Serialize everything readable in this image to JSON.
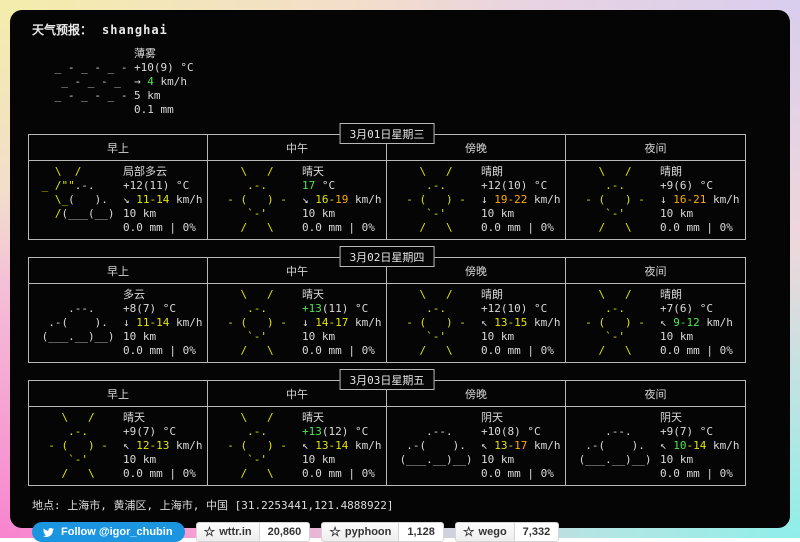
{
  "header": {
    "label": "天气预报：",
    "location": "shanghai"
  },
  "colors": {
    "green": "#4fe44f",
    "yellow": "#e3e300",
    "orange": "#ffaa00",
    "text": "#d9d9d9",
    "panel_bg": "#050505",
    "twitter_blue": "#1b95e0"
  },
  "arts": {
    "mist": [
      [],
      [
        {
          "t": " _ - _ - _ -",
          "c": "w"
        }
      ],
      [
        {
          "t": "  _ - _ - _",
          "c": "w"
        }
      ],
      [
        {
          "t": " _ - _ - _ -",
          "c": "w"
        }
      ],
      []
    ],
    "sunny": [
      [
        {
          "t": "    \\   /",
          "c": "y"
        }
      ],
      [
        {
          "t": "     .-.",
          "c": "y"
        }
      ],
      [
        {
          "t": "  - (   ) -",
          "c": "y"
        }
      ],
      [
        {
          "t": "     `-'",
          "c": "y"
        }
      ],
      [
        {
          "t": "    /   \\",
          "c": "y"
        }
      ]
    ],
    "partly_cloudy": [
      [
        {
          "t": "   \\  /",
          "c": "y"
        }
      ],
      [
        {
          "t": " _ /\"\"",
          "c": "y"
        },
        {
          "t": ".-.",
          "c": "w"
        }
      ],
      [
        {
          "t": "   \\_",
          "c": "y"
        },
        {
          "t": "(   ).",
          "c": "w"
        }
      ],
      [
        {
          "t": "   /",
          "c": "y"
        },
        {
          "t": "(___(__)",
          "c": "w"
        }
      ],
      []
    ],
    "cloudy": [
      [],
      [
        {
          "t": "     .--.",
          "c": "w"
        }
      ],
      [
        {
          "t": "  .-(    ).",
          "c": "w"
        }
      ],
      [
        {
          "t": " (___.__)__)",
          "c": "w"
        }
      ],
      []
    ]
  },
  "current": {
    "art": "mist",
    "condition": "薄雾",
    "temp": [
      {
        "t": "+10(9) °C",
        "c": "w"
      }
    ],
    "wind": [
      {
        "t": "→ ",
        "c": "w"
      },
      {
        "t": "4",
        "c": "g"
      },
      {
        "t": " km/h",
        "c": "w"
      }
    ],
    "visibility": "5 km",
    "precip": "0.1 mm"
  },
  "days": [
    {
      "title": "3月01日星期三",
      "periods": [
        "早上",
        "中午",
        "傍晚",
        "夜间"
      ],
      "cells": [
        {
          "art": "partly_cloudy",
          "condition": "局部多云",
          "temp": [
            {
              "t": "+12(11) °C",
              "c": "w"
            }
          ],
          "wind": [
            {
              "t": "↘ ",
              "c": "w"
            },
            {
              "t": "11-14",
              "c": "y"
            },
            {
              "t": " km/h",
              "c": "w"
            }
          ],
          "visibility": "10 km",
          "precip": "0.0 mm | 0%"
        },
        {
          "art": "sunny",
          "condition": "晴天",
          "temp": [
            {
              "t": "17",
              "c": "g"
            },
            {
              "t": " °C",
              "c": "w"
            }
          ],
          "wind": [
            {
              "t": "↘ ",
              "c": "w"
            },
            {
              "t": "16-",
              "c": "y"
            },
            {
              "t": "19",
              "c": "o"
            },
            {
              "t": " km/h",
              "c": "w"
            }
          ],
          "visibility": "10 km",
          "precip": "0.0 mm | 0%"
        },
        {
          "art": "sunny",
          "condition": "晴朗",
          "temp": [
            {
              "t": "+12(10) °C",
              "c": "w"
            }
          ],
          "wind": [
            {
              "t": "↓ ",
              "c": "w"
            },
            {
              "t": "19-22",
              "c": "o"
            },
            {
              "t": " km/h",
              "c": "w"
            }
          ],
          "visibility": "10 km",
          "precip": "0.0 mm | 0%"
        },
        {
          "art": "sunny",
          "condition": "晴朗",
          "temp": [
            {
              "t": "+9(6) °C",
              "c": "w"
            }
          ],
          "wind": [
            {
              "t": "↓ ",
              "c": "w"
            },
            {
              "t": "16-21",
              "c": "o"
            },
            {
              "t": " km/h",
              "c": "w"
            }
          ],
          "visibility": "10 km",
          "precip": "0.0 mm | 0%"
        }
      ]
    },
    {
      "title": "3月02日星期四",
      "periods": [
        "早上",
        "中午",
        "傍晚",
        "夜间"
      ],
      "cells": [
        {
          "art": "cloudy",
          "condition": "多云",
          "temp": [
            {
              "t": "+8(7) °C",
              "c": "w"
            }
          ],
          "wind": [
            {
              "t": "↓ ",
              "c": "w"
            },
            {
              "t": "11-14",
              "c": "y"
            },
            {
              "t": " km/h",
              "c": "w"
            }
          ],
          "visibility": "10 km",
          "precip": "0.0 mm | 0%"
        },
        {
          "art": "sunny",
          "condition": "晴天",
          "temp": [
            {
              "t": "+13",
              "c": "g"
            },
            {
              "t": "(11) °C",
              "c": "w"
            }
          ],
          "wind": [
            {
              "t": "↓ ",
              "c": "w"
            },
            {
              "t": "14-17",
              "c": "y"
            },
            {
              "t": " km/h",
              "c": "w"
            }
          ],
          "visibility": "10 km",
          "precip": "0.0 mm | 0%"
        },
        {
          "art": "sunny",
          "condition": "晴朗",
          "temp": [
            {
              "t": "+12(10) °C",
              "c": "w"
            }
          ],
          "wind": [
            {
              "t": "↖ ",
              "c": "w"
            },
            {
              "t": "13-15",
              "c": "y"
            },
            {
              "t": " km/h",
              "c": "w"
            }
          ],
          "visibility": "10 km",
          "precip": "0.0 mm | 0%"
        },
        {
          "art": "sunny",
          "condition": "晴朗",
          "temp": [
            {
              "t": "+7(6) °C",
              "c": "w"
            }
          ],
          "wind": [
            {
              "t": "↖ ",
              "c": "w"
            },
            {
              "t": "9-12",
              "c": "g"
            },
            {
              "t": " km/h",
              "c": "w"
            }
          ],
          "visibility": "10 km",
          "precip": "0.0 mm | 0%"
        }
      ]
    },
    {
      "title": "3月03日星期五",
      "periods": [
        "早上",
        "中午",
        "傍晚",
        "夜间"
      ],
      "cells": [
        {
          "art": "sunny",
          "condition": "晴天",
          "temp": [
            {
              "t": "+9(7) °C",
              "c": "w"
            }
          ],
          "wind": [
            {
              "t": "↖ ",
              "c": "w"
            },
            {
              "t": "12-13",
              "c": "y"
            },
            {
              "t": " km/h",
              "c": "w"
            }
          ],
          "visibility": "10 km",
          "precip": "0.0 mm | 0%"
        },
        {
          "art": "sunny",
          "condition": "晴天",
          "temp": [
            {
              "t": "+13",
              "c": "g"
            },
            {
              "t": "(12) °C",
              "c": "w"
            }
          ],
          "wind": [
            {
              "t": "↖ ",
              "c": "w"
            },
            {
              "t": "13-14",
              "c": "y"
            },
            {
              "t": " km/h",
              "c": "w"
            }
          ],
          "visibility": "10 km",
          "precip": "0.0 mm | 0%"
        },
        {
          "art": "cloudy",
          "condition": "阴天",
          "temp": [
            {
              "t": "+10(8) °C",
              "c": "w"
            }
          ],
          "wind": [
            {
              "t": "↖ ",
              "c": "w"
            },
            {
              "t": "13-",
              "c": "y"
            },
            {
              "t": "17",
              "c": "o"
            },
            {
              "t": " km/h",
              "c": "w"
            }
          ],
          "visibility": "10 km",
          "precip": "0.0 mm | 0%"
        },
        {
          "art": "cloudy",
          "condition": "阴天",
          "temp": [
            {
              "t": "+9(7) °C",
              "c": "w"
            }
          ],
          "wind": [
            {
              "t": "↖ ",
              "c": "w"
            },
            {
              "t": "10",
              "c": "g"
            },
            {
              "t": "-14",
              "c": "y"
            },
            {
              "t": " km/h",
              "c": "w"
            }
          ],
          "visibility": "10 km",
          "precip": "0.0 mm | 0%"
        }
      ]
    }
  ],
  "footer": {
    "location_line": "地点: 上海市, 黄浦区, 上海市, 中国 [31.2253441,121.4888922]",
    "twitter": {
      "label": "Follow @igor_chubin"
    },
    "github_buttons": [
      {
        "name": "wttr.in",
        "count": "20,860"
      },
      {
        "name": "pyphoon",
        "count": "1,128"
      },
      {
        "name": "wego",
        "count": "7,332"
      }
    ]
  }
}
